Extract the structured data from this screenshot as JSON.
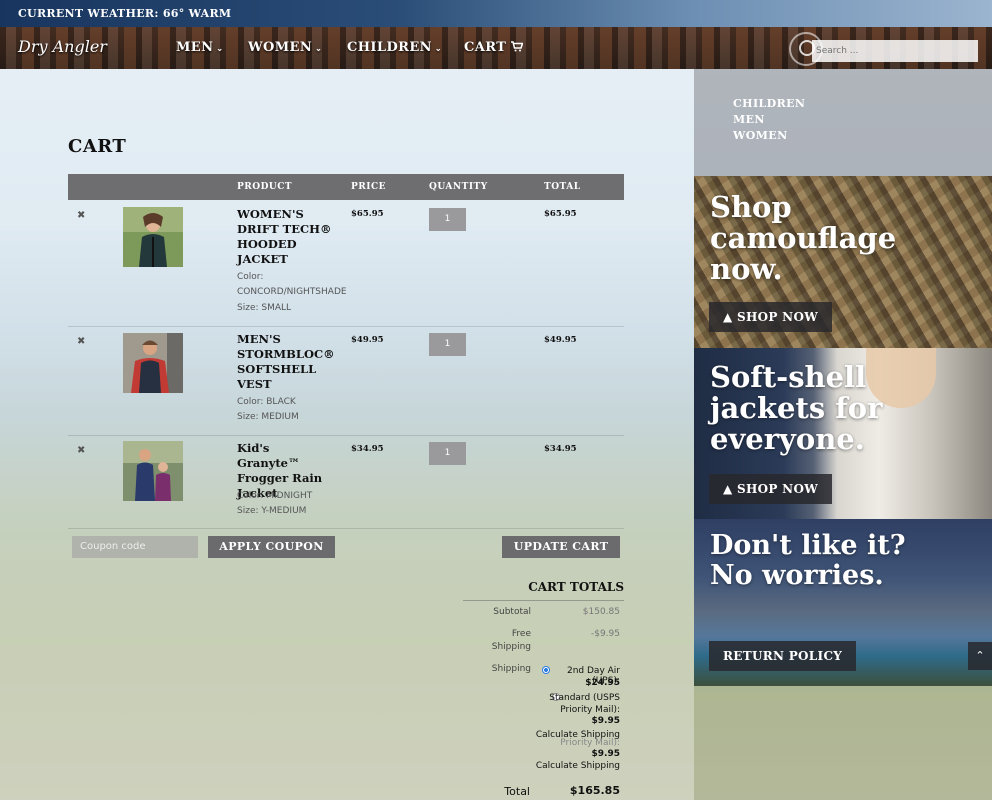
{
  "weather": {
    "text": "CURRENT WEATHER: 66° WARM"
  },
  "brand": {
    "logo_text": "Dry Angler"
  },
  "nav": {
    "items": [
      {
        "label": "MEN",
        "has_menu": true
      },
      {
        "label": "WOMEN",
        "has_menu": true
      },
      {
        "label": "CHILDREN",
        "has_menu": true
      },
      {
        "label": "CART",
        "has_menu": false
      }
    ],
    "cart_icon": "cart-icon",
    "search_placeholder": "Search ..."
  },
  "cart": {
    "title": "CART",
    "columns": [
      "PRODUCT",
      "PRICE",
      "QUANTITY",
      "TOTAL"
    ],
    "items": [
      {
        "name": "WOMEN'S DRIFT TECH® HOODED JACKET",
        "color_label": "Color:",
        "color": "CONCORD/NIGHTSHADE",
        "size": "Size: SMALL",
        "price": "$65.95",
        "quantity": "1",
        "total": "$65.95"
      },
      {
        "name": "MEN'S STORMBLOC® SOFTSHELL VEST",
        "color": "Color: BLACK",
        "size": "Size: MEDIUM",
        "price": "$49.95",
        "quantity": "1",
        "total": "$49.95"
      },
      {
        "name": "Kid's Granyte™ Frogger Rain Jacket",
        "color": "Color: MIDNIGHT",
        "size": "Size: Y-MEDIUM",
        "price": "$34.95",
        "quantity": "1",
        "total": "$34.95"
      }
    ],
    "remove_icon": "✖",
    "coupon_placeholder": "Coupon code",
    "apply_coupon_label": "APPLY COUPON",
    "update_cart_label": "UPDATE CART"
  },
  "totals": {
    "title": "CART TOTALS",
    "subtotal_label": "Subtotal",
    "subtotal_value": "$150.85",
    "free_shipping_label_1": "Free",
    "free_shipping_label_2": "Shipping",
    "free_shipping_value": "-$9.95",
    "shipping_label": "Shipping",
    "option1_label": "2nd Day Air (UPS):",
    "option1_price": "$24.95",
    "option2_label_1": "Standard (USPS",
    "option2_label_2": "Priority Mail):",
    "option2_price": "$9.95",
    "calc_shipping": "Calculate Shipping",
    "ghost_line": "Priority Mail):",
    "ghost_price": "$9.95",
    "ghost_calc": "Calculate Shipping",
    "total_label": "Total",
    "total_value": "$165.85"
  },
  "sidebar": {
    "categories": [
      "CHILDREN",
      "MEN",
      "WOMEN"
    ],
    "promos": [
      {
        "headline_1": "Shop",
        "headline_2": "camouflage",
        "headline_3": "now.",
        "button": "SHOP NOW",
        "button_icon": "tree-icon"
      },
      {
        "headline_1": "Soft-shell",
        "headline_2": "jackets for",
        "headline_3": "everyone.",
        "button": "SHOP NOW",
        "button_icon": "tree-icon"
      },
      {
        "headline_1": "Don't like it?",
        "headline_2": "No worries.",
        "button": "RETURN POLICY"
      }
    ]
  },
  "ui": {
    "back_to_top_icon": "chevron-up-icon"
  }
}
